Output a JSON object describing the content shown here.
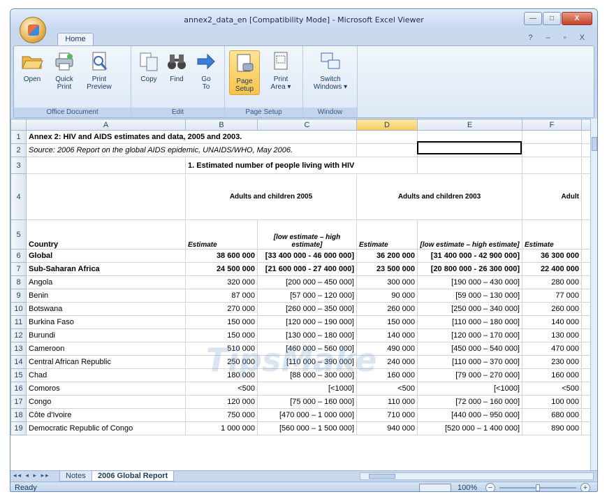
{
  "window": {
    "title": "annex2_data_en  [Compatibility Mode] - Microsoft Excel Viewer",
    "controls": {
      "minimize": "—",
      "maximize": "□",
      "close": "X"
    }
  },
  "ribbon": {
    "tabs": [
      {
        "label": "Home"
      }
    ],
    "right_icons": "? – ▫ X",
    "groups": [
      {
        "label": "Office Document",
        "buttons": [
          {
            "label": "Open",
            "icon": "folder-open-icon"
          },
          {
            "label": "Quick\nPrint",
            "icon": "printer-icon"
          },
          {
            "label": "Print\nPreview",
            "icon": "print-preview-icon"
          }
        ]
      },
      {
        "label": "Edit",
        "buttons": [
          {
            "label": "Copy",
            "icon": "copy-icon"
          },
          {
            "label": "Find",
            "icon": "binoculars-icon"
          },
          {
            "label": "Go\nTo",
            "icon": "arrow-right-icon"
          }
        ]
      },
      {
        "label": "Page Setup",
        "buttons": [
          {
            "label": "Page\nSetup",
            "icon": "page-setup-icon",
            "active": true
          },
          {
            "label": "Print\nArea ▾",
            "icon": "print-area-icon"
          }
        ]
      },
      {
        "label": "Window",
        "buttons": [
          {
            "label": "Switch\nWindows ▾",
            "icon": "switch-windows-icon"
          }
        ]
      }
    ]
  },
  "grid": {
    "columns": [
      "A",
      "B",
      "C",
      "D",
      "E",
      "F"
    ],
    "selected_column": "D",
    "rows": [
      {
        "n": "1",
        "a": "Annex 2: HIV and AIDS estimates and data, 2005 and 2003.",
        "b": "",
        "c": "",
        "d": "",
        "e": "",
        "f": ""
      },
      {
        "n": "2",
        "a": "Source: 2006 Report on the global AIDS epidemic, UNAIDS/WHO, May 2006.",
        "b": "",
        "c": "",
        "d": "",
        "e": "",
        "f": ""
      },
      {
        "n": "3",
        "a": "",
        "b": "1. Estimated number of people living with HIV",
        "c": "",
        "d": "",
        "e": "",
        "f": ""
      },
      {
        "n": "4",
        "a": "",
        "bc": "Adults and children 2005",
        "de": "Adults and children 2003",
        "f": "Adult"
      },
      {
        "n": "5",
        "a": "Country",
        "b": "Estimate",
        "c": "[low estimate – high estimate]",
        "d": "Estimate",
        "e": "[low estimate – high estimate]",
        "f": "Estimate"
      },
      {
        "n": "6",
        "a": "Global",
        "b": "38 600 000",
        "c": "[33 400 000 - 46 000 000]",
        "d": "36 200 000",
        "e": "[31 400 000 - 42 900 000]",
        "f": "36 300 000",
        "bold": true
      },
      {
        "n": "7",
        "a": "Sub-Saharan Africa",
        "b": "24 500 000",
        "c": "[21 600 000 - 27 400 000]",
        "d": "23 500 000",
        "e": "[20 800 000 - 26 300 000]",
        "f": "22 400 000",
        "bold": true
      },
      {
        "n": "8",
        "a": "Angola",
        "b": "320 000",
        "c": "[200 000 – 450 000]",
        "d": "300 000",
        "e": "[190 000 – 430 000]",
        "f": "280 000"
      },
      {
        "n": "9",
        "a": "Benin",
        "b": "87 000",
        "c": "[57 000 – 120 000]",
        "d": "90 000",
        "e": "[59 000 – 130 000]",
        "f": "77 000"
      },
      {
        "n": "10",
        "a": "Botswana",
        "b": "270 000",
        "c": "[260 000 – 350 000]",
        "d": "260 000",
        "e": "[250 000 – 340 000]",
        "f": "260 000"
      },
      {
        "n": "11",
        "a": "Burkina Faso",
        "b": "150 000",
        "c": "[120 000 – 190 000]",
        "d": "150 000",
        "e": "[110 000 – 180 000]",
        "f": "140 000"
      },
      {
        "n": "12",
        "a": "Burundi",
        "b": "150 000",
        "c": "[130 000 – 180 000]",
        "d": "140 000",
        "e": "[120 000 – 170 000]",
        "f": "130 000"
      },
      {
        "n": "13",
        "a": "Cameroon",
        "b": "510 000",
        "c": "[460 000 – 560 000]",
        "d": "490 000",
        "e": "[450 000 – 540 000]",
        "f": "470 000"
      },
      {
        "n": "14",
        "a": "Central African Republic",
        "b": "250 000",
        "c": "[110 000 – 390 000]",
        "d": "240 000",
        "e": "[110 000 – 370 000]",
        "f": "230 000"
      },
      {
        "n": "15",
        "a": "Chad",
        "b": "180 000",
        "c": "[88 000 – 300 000]",
        "d": "160 000",
        "e": "[79 000 – 270 000]",
        "f": "160 000"
      },
      {
        "n": "16",
        "a": "Comoros",
        "b": "<500",
        "c": "[<1000]",
        "d": "<500",
        "e": "[<1000]",
        "f": "<500"
      },
      {
        "n": "17",
        "a": "Congo",
        "b": "120 000",
        "c": "[75 000 – 160 000]",
        "d": "110 000",
        "e": "[72 000 – 160 000]",
        "f": "100 000"
      },
      {
        "n": "18",
        "a": "Côte d'Ivoire",
        "b": "750 000",
        "c": "[470 000 – 1 000 000]",
        "d": "710 000",
        "e": "[440 000 – 950 000]",
        "f": "680 000"
      },
      {
        "n": "19",
        "a": "Democratic Republic of Congo",
        "b": "1 000 000",
        "c": "[560 000 – 1 500 000]",
        "d": "940 000",
        "e": "[520 000 – 1 400 000]",
        "f": "890 000"
      }
    ]
  },
  "sheets": {
    "nav": "◂◂ ◂ ▸ ▸▸",
    "tabs": [
      "Notes",
      "2006 Global Report"
    ],
    "active": "2006 Global Report"
  },
  "status": {
    "text": "Ready",
    "zoom": "100%"
  },
  "watermark": "TipsMake",
  "colors": {
    "ribbon": "#dce8f6",
    "selected_header": "#f7c95b",
    "title_close": "#c3402a"
  }
}
